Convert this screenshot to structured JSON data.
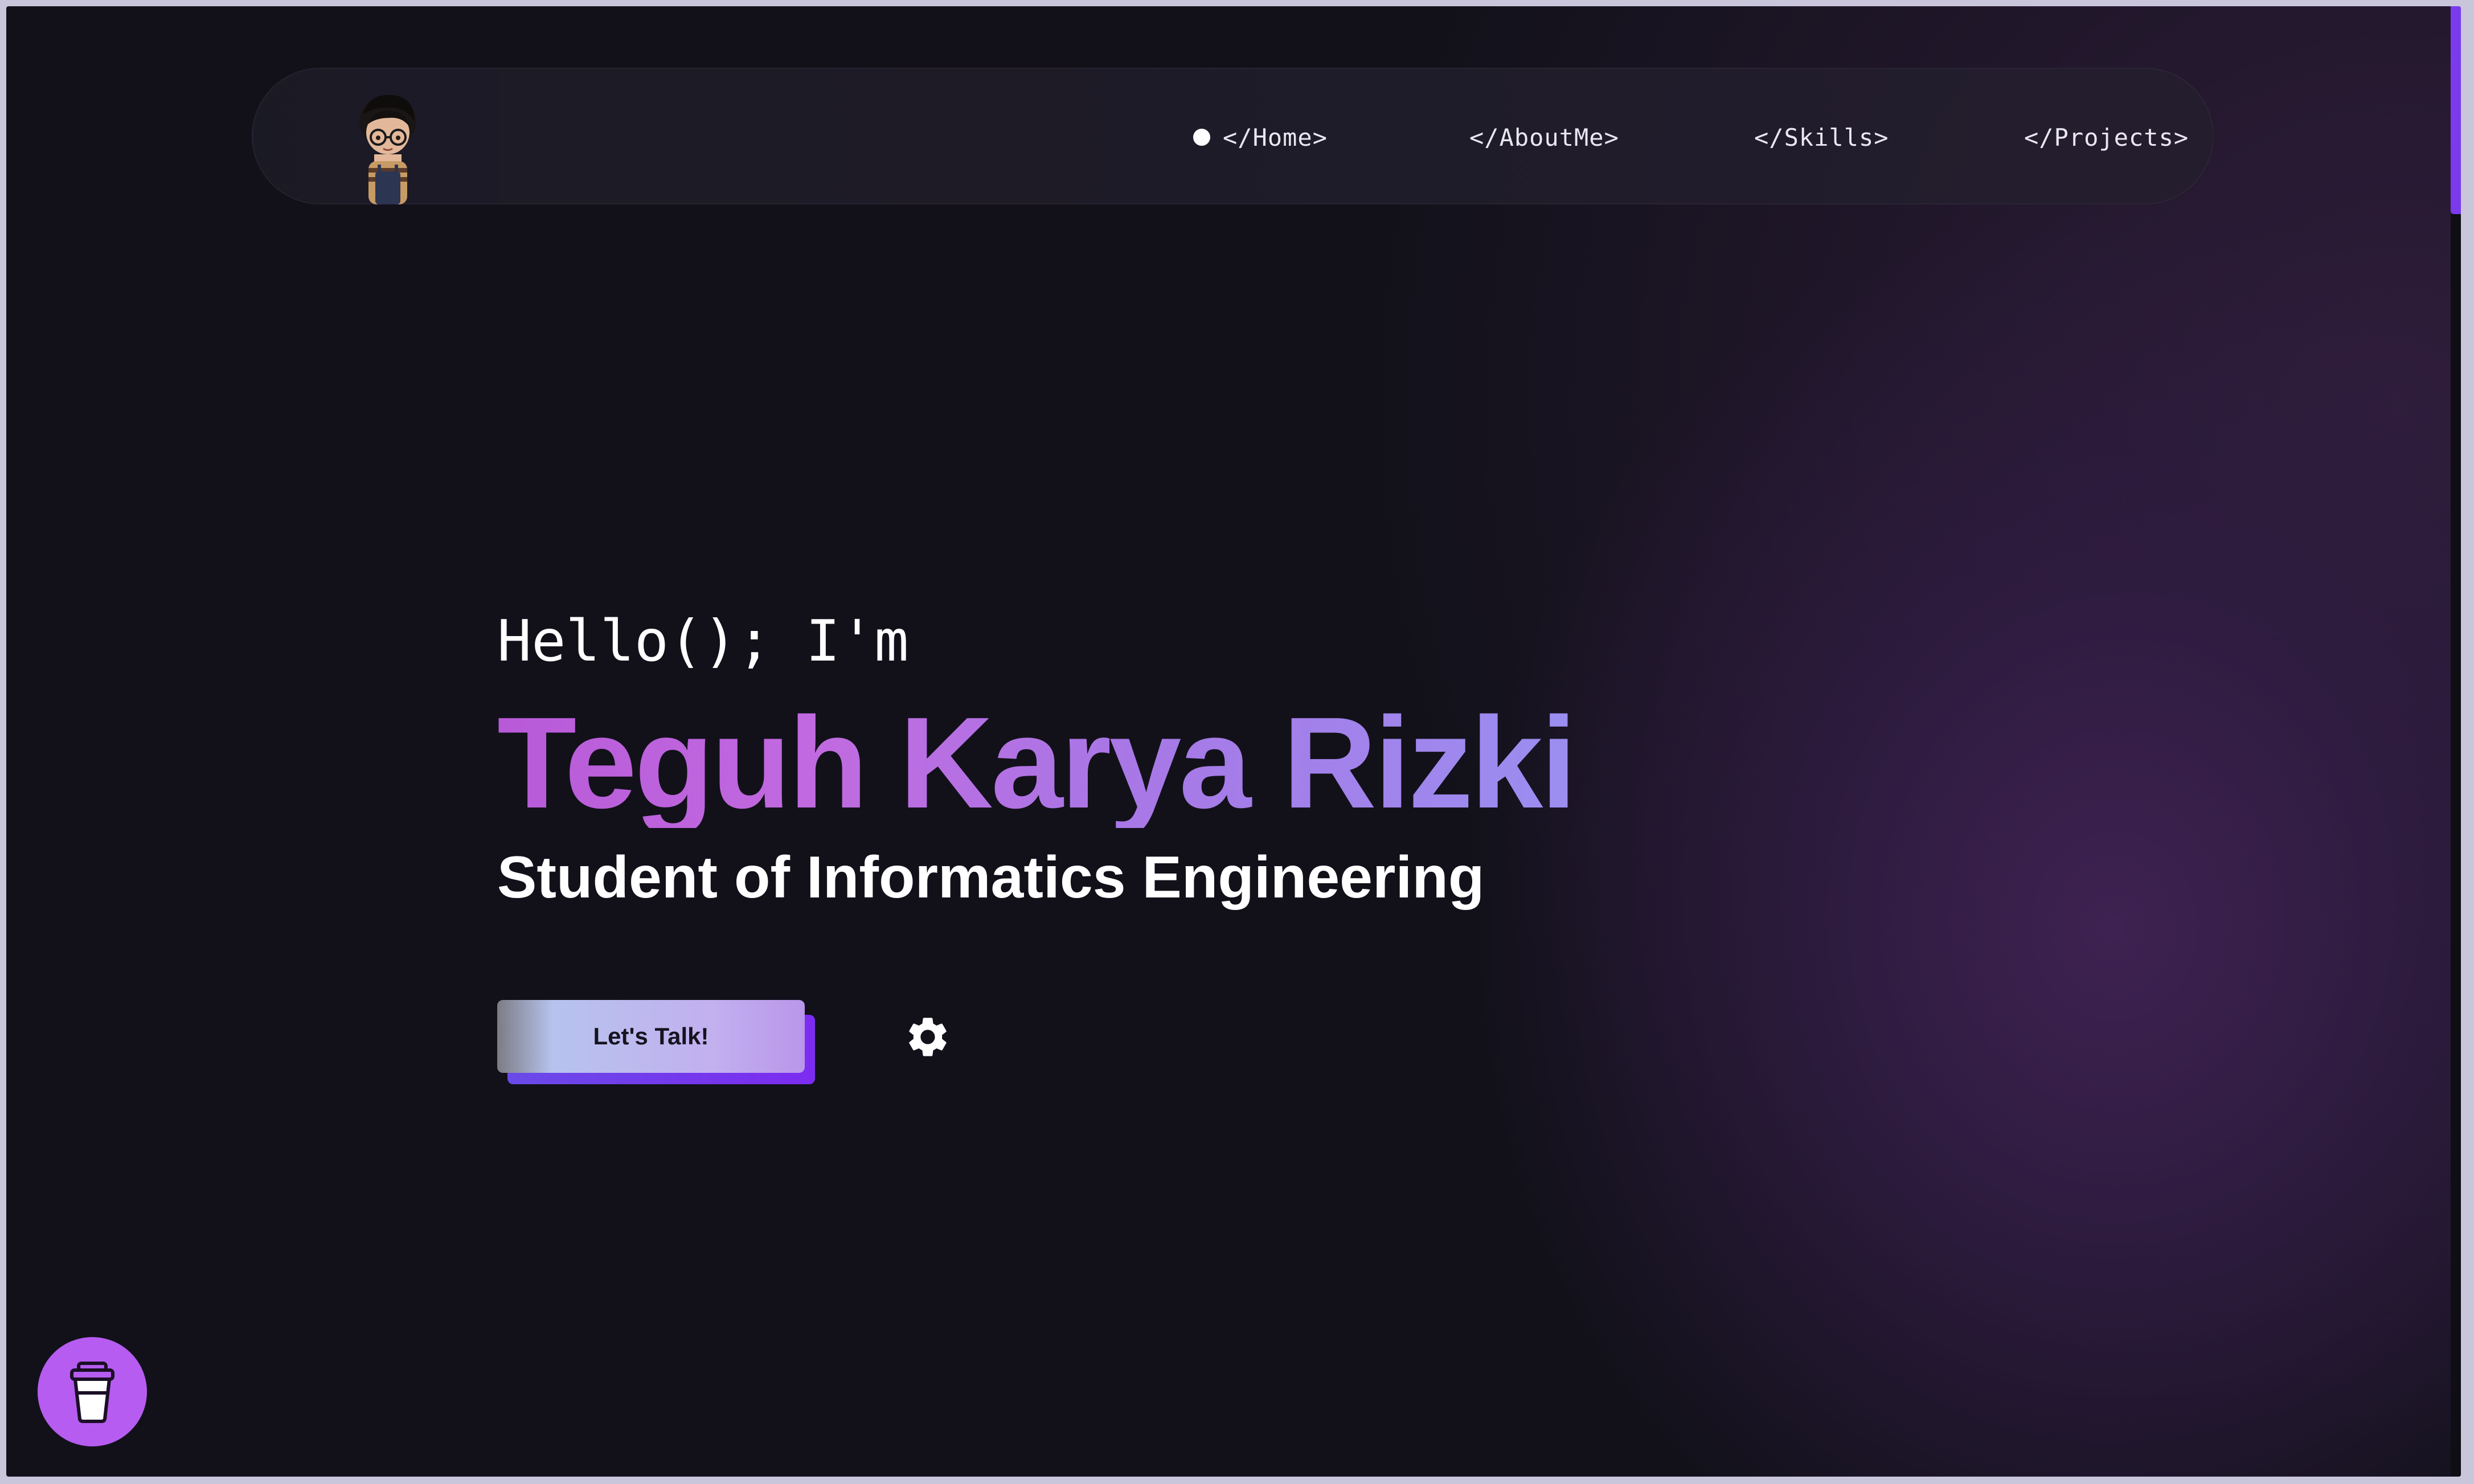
{
  "nav": {
    "items": [
      {
        "label": "</Home>",
        "active": true
      },
      {
        "label": "</AboutMe>"
      },
      {
        "label": "</Skills>"
      },
      {
        "label": "</Projects>"
      }
    ]
  },
  "hero": {
    "greeting": "Hello(); I'm",
    "name": "Teguh Karya Rizki",
    "subtitle": "Student of Informatics Engineering",
    "cta_label": "Let's Talk!"
  },
  "icons": {
    "avatar": "avatar-character-icon",
    "active_indicator": "dot-icon",
    "settings": "gear-icon",
    "coffee": "coffee-cup-icon"
  },
  "colors": {
    "accent": "#7c3aed",
    "name_gradient_start": "#b85ad8",
    "name_gradient_end": "#9b8ef0",
    "coffee_button": "#b65cf0",
    "background": "#12111a"
  }
}
